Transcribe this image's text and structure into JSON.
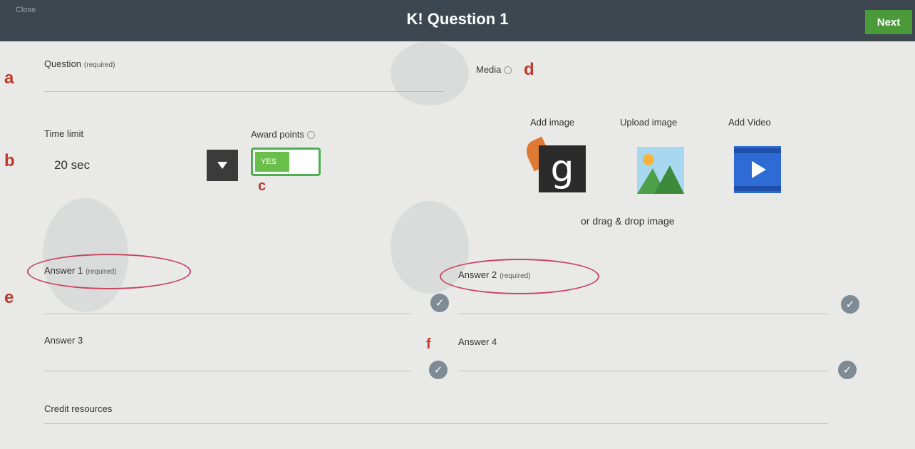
{
  "header": {
    "close_label": "Close",
    "title": "K! Question 1",
    "next_label": "Next"
  },
  "question": {
    "label": "Question",
    "required": "(required)"
  },
  "time_limit": {
    "label": "Time limit",
    "value": "20 sec"
  },
  "award_points": {
    "label": "Award points",
    "toggle_label": "YES",
    "on": true
  },
  "media": {
    "label": "Media",
    "add_image": "Add image",
    "upload_image": "Upload image",
    "add_video": "Add Video",
    "drop_hint": "or drag & drop image"
  },
  "answers": [
    {
      "label": "Answer 1",
      "required": "(required)"
    },
    {
      "label": "Answer 2",
      "required": "(required)"
    },
    {
      "label": "Answer 3"
    },
    {
      "label": "Answer 4"
    }
  ],
  "credit": {
    "label": "Credit resources"
  },
  "annotations": {
    "a": "a",
    "b": "b",
    "c": "c",
    "d": "d",
    "e": "e",
    "f": "f"
  },
  "icons": [
    "dropdown-arrow-icon",
    "info-icon",
    "google-g-icon",
    "image-icon",
    "video-play-icon",
    "check-circle-icon"
  ],
  "colors": {
    "header": "#3c4750",
    "next": "#4b9a3a",
    "toggle": "#6abf4b",
    "marker": "#c0392b",
    "circle": "#c74761"
  }
}
